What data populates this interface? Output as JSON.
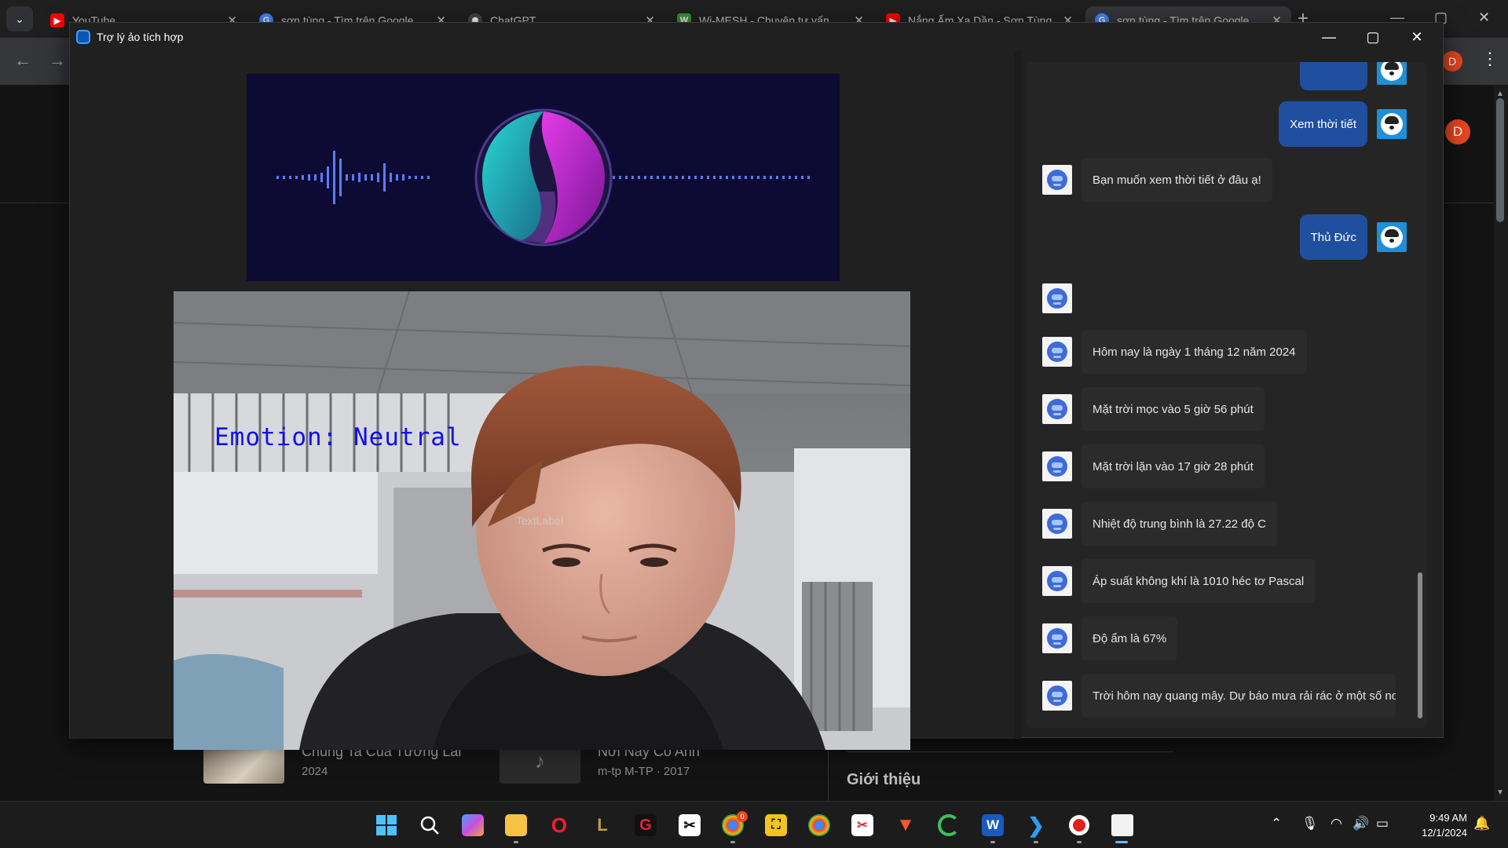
{
  "browser": {
    "tabs": [
      {
        "title": "YouTube",
        "favicon_color": "#ff0000"
      },
      {
        "title": "sơn tùng - Tìm trên Google",
        "favicon_color": "#4285f4"
      },
      {
        "title": "ChatGPT",
        "favicon_color": "#555555"
      },
      {
        "title": "Wi-MESH - Chuyên tư vấn",
        "favicon_color": "#3a8f3a"
      },
      {
        "title": "Nắng Ấm Xa Dần - Sơn Tùng",
        "favicon_color": "#ff0000"
      },
      {
        "title": "sơn tùng - Tìm trên Google",
        "favicon_color": "#4285f4"
      }
    ],
    "profile_initial": "D",
    "intro_heading": "Giới thiệu",
    "songs": [
      {
        "title": "Chúng Ta Của Tương Lai",
        "sub": "2024"
      },
      {
        "title": "Nơi Này Có Anh",
        "sub": "m-tp M-TP · 2017"
      }
    ]
  },
  "app": {
    "title": "Trợ lý ảo tích hợp",
    "emotion_text": "Emotion: Neutral",
    "placeholder_label": "TextLabel"
  },
  "chat": {
    "messages": [
      {
        "role": "user",
        "text": "Xem thời tiết"
      },
      {
        "role": "bot",
        "text": "Bạn muốn xem thời tiết ở đâu ạ!"
      },
      {
        "role": "user",
        "text": "Thủ Đức"
      },
      {
        "role": "bot",
        "text": ""
      },
      {
        "role": "bot",
        "text": "Hôm nay là ngày 1 tháng 12 năm 2024"
      },
      {
        "role": "bot",
        "text": "Mặt trời mọc vào 5 giờ 56 phút"
      },
      {
        "role": "bot",
        "text": "Mặt trời lặn vào 17 giờ 28 phút"
      },
      {
        "role": "bot",
        "text": "Nhiệt độ trung bình là 27.22 độ C"
      },
      {
        "role": "bot",
        "text": "Áp suất không khí là 1010 héc tơ Pascal"
      },
      {
        "role": "bot",
        "text": "Độ ẩm là 67%"
      },
      {
        "role": "bot",
        "text": "Trời hôm nay quang mây. Dự báo mưa rải rác ở một số nơi"
      }
    ]
  },
  "taskbar": {
    "time": "9:49 AM",
    "date": "12/1/2024",
    "chrome_badge": "0"
  }
}
